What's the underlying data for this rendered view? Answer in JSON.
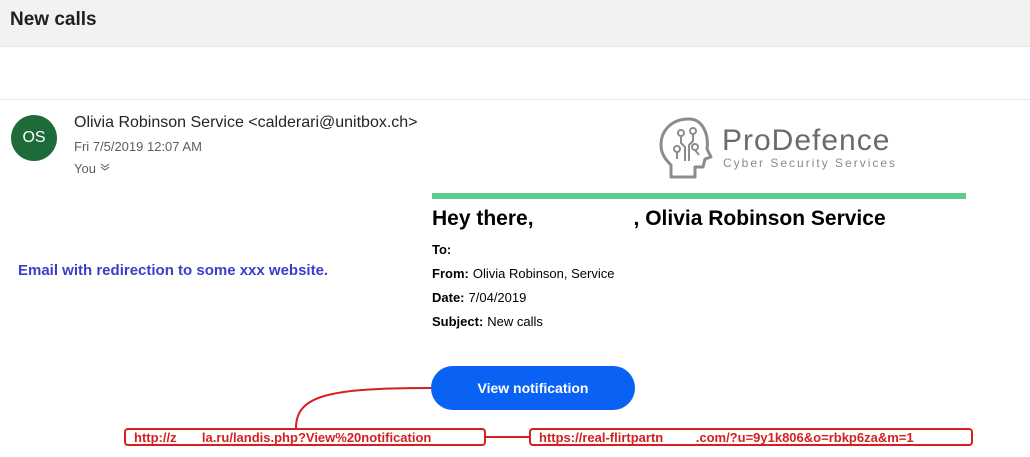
{
  "header": {
    "subject": "New calls"
  },
  "message": {
    "avatar_initials": "OS",
    "sender": "Olivia Robinson Service <calderari@unitbox.ch>",
    "date": "Fri 7/5/2019 12:07 AM",
    "recipients": "You"
  },
  "annotation": {
    "note": "Email with redirection to some xxx website.",
    "url_1": "http://z       la.ru/landis.php?View%20notification",
    "url_2": "https://real-flirtpartn         .com/?u=9y1k806&o=rbkp6za&m=1",
    "color": "#d42020"
  },
  "brand": {
    "name": "ProDefence",
    "tagline": "Cyber Security Services"
  },
  "email_body": {
    "greeting_start": "Hey there,",
    "greeting_end": ", Olivia Robinson Service",
    "to_label": "To:",
    "to_value": "",
    "from_label": "From:",
    "from_value": "Olivia Robinson, Service",
    "date_label": "Date:",
    "date_value": "7/04/2019",
    "subject_label": "Subject:",
    "subject_value": "New calls",
    "button_label": "View notification",
    "accent_color": "#0a62f5",
    "bar_color": "#5ecc8c"
  }
}
